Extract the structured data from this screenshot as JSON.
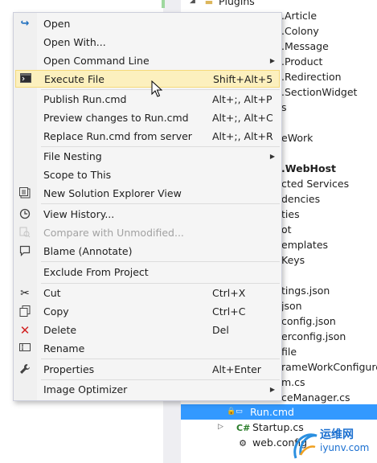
{
  "tree": {
    "items": [
      {
        "label": "Plugins",
        "icon": "folder-icon"
      },
      {
        "label": ".Article"
      },
      {
        "label": ".Colony"
      },
      {
        "label": ".Message"
      },
      {
        "label": ".Product"
      },
      {
        "label": ".Redirection"
      },
      {
        "label": ".SectionWidget"
      },
      {
        "label": "s"
      },
      {
        "label": "eWork"
      },
      {
        "label": ".WebHost"
      },
      {
        "label": "cted Services"
      },
      {
        "label": "dencies"
      },
      {
        "label": "ties"
      },
      {
        "label": "ot"
      },
      {
        "label": "emplates"
      },
      {
        "label": "Keys"
      },
      {
        "label": "tings.json"
      },
      {
        "label": "json"
      },
      {
        "label": "config.json"
      },
      {
        "label": "erconfig.json"
      },
      {
        "label": "file"
      },
      {
        "label": "rameWorkConfigure"
      },
      {
        "label": "m.cs"
      },
      {
        "label": "ceManager.cs"
      },
      {
        "label": "Run.cmd",
        "icon": "cmd-file-icon"
      },
      {
        "label": "Startup.cs",
        "icon": "csharp-file-icon"
      },
      {
        "label": "web.config",
        "icon": "config-file-icon"
      }
    ]
  },
  "menu": {
    "items": [
      {
        "label": "Open",
        "shortcut": "",
        "icon": "open-arrow-icon"
      },
      {
        "label": "Open With...",
        "shortcut": ""
      },
      {
        "label": "Open Command Line",
        "shortcut": "",
        "submenu": true
      },
      {
        "label": "Execute File",
        "shortcut": "Shift+Alt+5",
        "icon": "console-icon"
      },
      {
        "label": "Publish Run.cmd",
        "shortcut": "Alt+;, Alt+P"
      },
      {
        "label": "Preview changes to Run.cmd",
        "shortcut": "Alt+;, Alt+C"
      },
      {
        "label": "Replace Run.cmd from server",
        "shortcut": "Alt+;, Alt+R"
      },
      {
        "label": "File Nesting",
        "shortcut": "",
        "submenu": true
      },
      {
        "label": "Scope to This",
        "shortcut": ""
      },
      {
        "label": "New Solution Explorer View",
        "shortcut": "",
        "icon": "new-view-icon"
      },
      {
        "label": "View History...",
        "shortcut": "",
        "icon": "history-icon"
      },
      {
        "label": "Compare with Unmodified...",
        "shortcut": "",
        "icon": "compare-icon"
      },
      {
        "label": "Blame (Annotate)",
        "shortcut": "",
        "icon": "annotate-icon"
      },
      {
        "label": "Exclude From Project",
        "shortcut": ""
      },
      {
        "label": "Cut",
        "shortcut": "Ctrl+X",
        "icon": "scissors-icon"
      },
      {
        "label": "Copy",
        "shortcut": "Ctrl+C",
        "icon": "copy-icon"
      },
      {
        "label": "Delete",
        "shortcut": "Del",
        "icon": "delete-x-icon"
      },
      {
        "label": "Rename",
        "shortcut": "",
        "icon": "rename-icon"
      },
      {
        "label": "Properties",
        "shortcut": "Alt+Enter",
        "icon": "wrench-icon"
      },
      {
        "label": "Image Optimizer",
        "shortcut": "",
        "submenu": true
      }
    ],
    "hovered": "Execute File",
    "disabled": "Compare with Unmodified..."
  },
  "watermark": {
    "title": "运维网",
    "subtitle": "iyunv.com"
  },
  "colors": {
    "selection": "#3399ff",
    "hover": "#fcf0be",
    "delete": "#d22020"
  }
}
